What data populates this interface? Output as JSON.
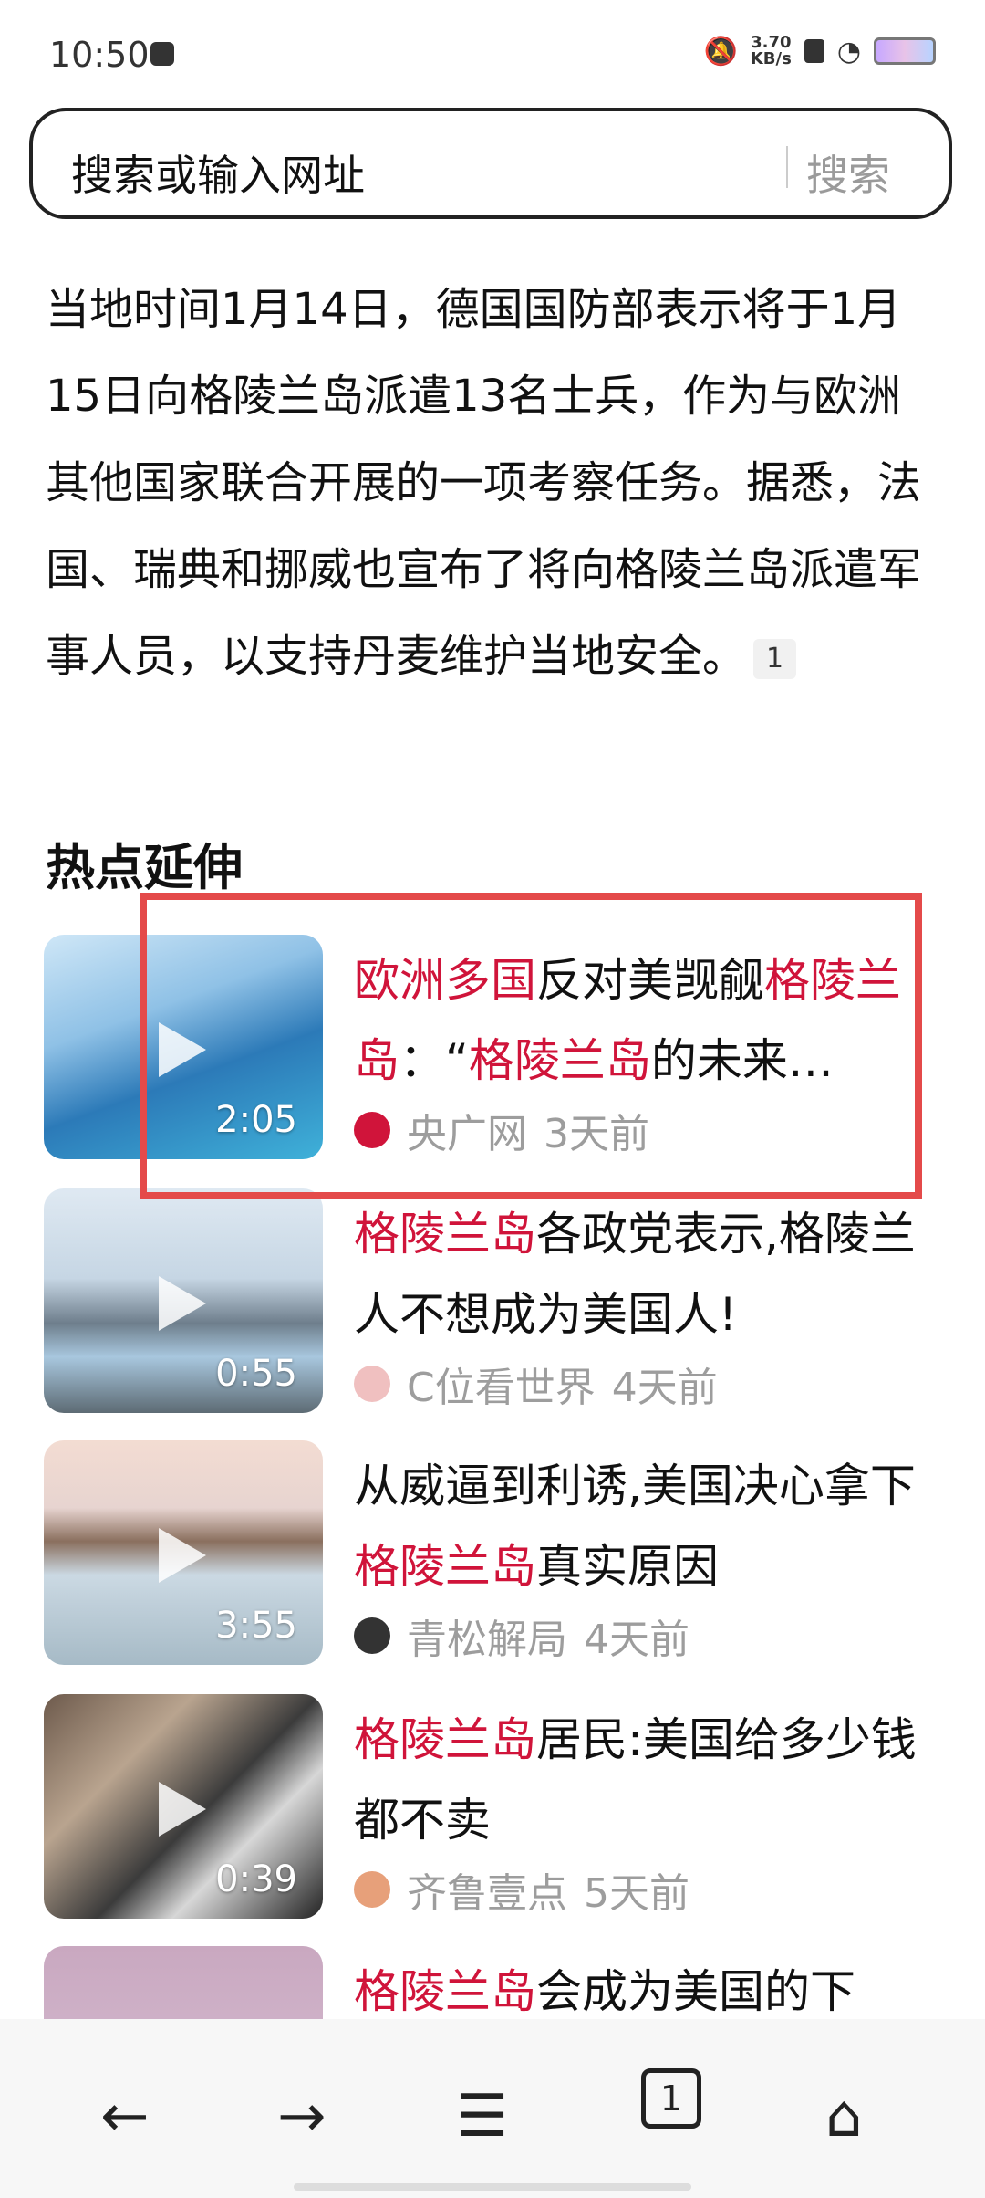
{
  "status_bar": {
    "time": "10:50",
    "network_speed_value": "3.70",
    "network_speed_unit": "KB/s"
  },
  "search": {
    "placeholder": "搜索或输入网址",
    "button_label": "搜索"
  },
  "article": {
    "text": "当地时间1月14日，德国国防部表示将于1月15日向格陵兰岛派遣13名士兵，作为与欧洲其他国家联合开展的一项考察任务。据悉，法国、瑞典和挪威也宣布了将向格陵兰岛派遣军事人员，以支持丹麦维护当地安全。",
    "reference": "1"
  },
  "section_title": "热点延伸",
  "news": [
    {
      "duration": "2:05",
      "title_parts": [
        {
          "text": "欧洲多国",
          "hl": true
        },
        {
          "text": "反对美觊觎",
          "hl": false
        },
        {
          "text": "格陵兰岛",
          "hl": true
        },
        {
          "text": "：“",
          "hl": false
        },
        {
          "text": "格陵兰岛",
          "hl": true
        },
        {
          "text": "的未来…",
          "hl": false
        }
      ],
      "source": "央广网",
      "time": "3天前"
    },
    {
      "duration": "0:55",
      "title_parts": [
        {
          "text": "格陵兰岛",
          "hl": true
        },
        {
          "text": "各政党表示,格陵兰人不想成为美国人!",
          "hl": false
        }
      ],
      "source": "C位看世界",
      "time": "4天前"
    },
    {
      "duration": "3:55",
      "title_parts": [
        {
          "text": "从威逼到利诱,美国决心拿下",
          "hl": false
        },
        {
          "text": "格陵兰岛",
          "hl": true
        },
        {
          "text": "真实原因",
          "hl": false
        }
      ],
      "source": "青松解局",
      "time": "4天前"
    },
    {
      "duration": "0:39",
      "title_parts": [
        {
          "text": "格陵兰岛",
          "hl": true
        },
        {
          "text": "居民:美国给多少钱都不卖",
          "hl": false
        }
      ],
      "source": "齐鲁壹点",
      "time": "5天前"
    },
    {
      "duration": "",
      "title_parts": [
        {
          "text": "格陵兰岛",
          "hl": true
        },
        {
          "text": "会成为美国的下",
          "hl": false
        }
      ],
      "source": "",
      "time": ""
    }
  ],
  "bottom_nav": {
    "tab_count": "1"
  },
  "colors": {
    "highlight_text": "#d0143a",
    "annotation_box": "#e44a4a"
  }
}
